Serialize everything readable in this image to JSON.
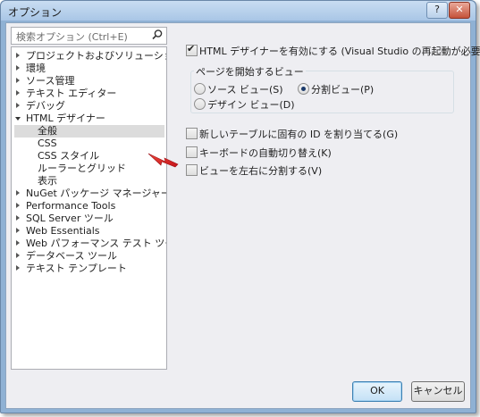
{
  "window": {
    "title": "オプション",
    "help": "?",
    "close": "✕"
  },
  "search": {
    "placeholder": "検索オプション (Ctrl+E)"
  },
  "tree": [
    {
      "label": "プロジェクトおよびソリューション"
    },
    {
      "label": "環境"
    },
    {
      "label": "ソース管理"
    },
    {
      "label": "テキスト エディター"
    },
    {
      "label": "デバッグ"
    },
    {
      "label": "HTML デザイナー"
    },
    {
      "label": "全般"
    },
    {
      "label": "CSS"
    },
    {
      "label": "CSS スタイル"
    },
    {
      "label": "ルーラーとグリッド"
    },
    {
      "label": "表示"
    },
    {
      "label": "NuGet パッケージ マネージャー"
    },
    {
      "label": "Performance Tools"
    },
    {
      "label": "SQL Server ツール"
    },
    {
      "label": "Web Essentials"
    },
    {
      "label": "Web パフォーマンス テスト ツール"
    },
    {
      "label": "データベース ツール"
    },
    {
      "label": "テキスト テンプレート"
    }
  ],
  "options": {
    "enable_html_designer": "HTML デザイナーを有効にする (Visual Studio の再起動が必要)(E)",
    "start_view_group": "ページを開始するビュー",
    "source_view": "ソース ビュー(S)",
    "split_view": "分割ビュー(P)",
    "design_view": "デザイン ビュー(D)",
    "assign_id": "新しいテーブルに固有の ID を割り当てる(G)",
    "auto_switch_keyboard": "キーボードの自動切り替え(K)",
    "split_left_right": "ビューを左右に分割する(V)"
  },
  "buttons": {
    "ok": "OK",
    "cancel": "キャンセル"
  },
  "colors": {
    "annotation_arrow": "#e02020",
    "selection": "#dcdcdc"
  }
}
